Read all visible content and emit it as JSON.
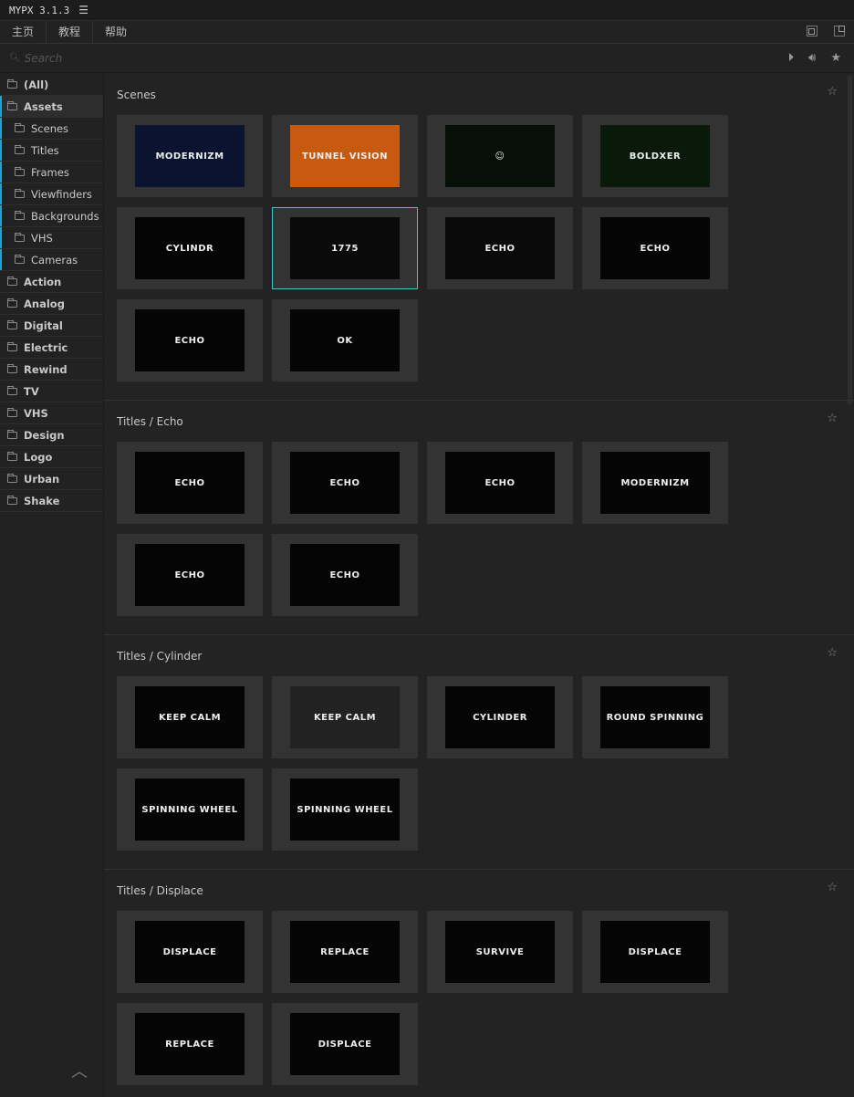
{
  "app": {
    "title": "MYPX 3.1.3",
    "menu_icon": "hamburger-icon"
  },
  "menu": [
    "主页",
    "教程",
    "帮助"
  ],
  "search": {
    "placeholder": "Search",
    "value": ""
  },
  "toolbar_icons": [
    "play-icon",
    "volume-icon",
    "star-icon"
  ],
  "sidebar": [
    {
      "label": "(All)",
      "sub": false
    },
    {
      "label": "Assets",
      "sub": false,
      "active": true
    },
    {
      "label": "Scenes",
      "sub": true
    },
    {
      "label": "Titles",
      "sub": true
    },
    {
      "label": "Frames",
      "sub": true
    },
    {
      "label": "Viewfinders",
      "sub": true
    },
    {
      "label": "Backgrounds",
      "sub": true
    },
    {
      "label": "VHS",
      "sub": true
    },
    {
      "label": "Cameras",
      "sub": true
    },
    {
      "label": "Action",
      "sub": false
    },
    {
      "label": "Analog",
      "sub": false
    },
    {
      "label": "Digital",
      "sub": false
    },
    {
      "label": "Electric",
      "sub": false
    },
    {
      "label": "Rewind",
      "sub": false
    },
    {
      "label": "TV",
      "sub": false
    },
    {
      "label": "VHS",
      "sub": false
    },
    {
      "label": "Design",
      "sub": false
    },
    {
      "label": "Logo",
      "sub": false
    },
    {
      "label": "Urban",
      "sub": false
    },
    {
      "label": "Shake",
      "sub": false
    }
  ],
  "sections": [
    {
      "title": "Scenes",
      "items": [
        {
          "label": "MODERNIZM",
          "bg": "#0a1430"
        },
        {
          "label": "TUNNEL VISION",
          "bg": "#c85a10"
        },
        {
          "label": "☺",
          "bg": "#061008"
        },
        {
          "label": "BOLDXER",
          "bg": "#0a1a0a"
        },
        {
          "label": "CYLINDR",
          "bg": "#050505"
        },
        {
          "label": "1775",
          "bg": "#0a0a0a",
          "selected": true
        },
        {
          "label": "ECHO",
          "bg": "#0a0a0a"
        },
        {
          "label": "ECHO",
          "bg": "#050505"
        },
        {
          "label": "ECHO",
          "bg": "#050505"
        },
        {
          "label": "OK",
          "bg": "#050505"
        }
      ]
    },
    {
      "title": "Titles / Echo",
      "items": [
        {
          "label": "ECHO",
          "bg": "#050505"
        },
        {
          "label": "ECHO",
          "bg": "#050505"
        },
        {
          "label": "ECHO",
          "bg": "#050505"
        },
        {
          "label": "MODERNIZM",
          "bg": "#050505"
        },
        {
          "label": "ECHO",
          "bg": "#050505"
        },
        {
          "label": "ECHO",
          "bg": "#050505"
        }
      ]
    },
    {
      "title": "Titles / Cylinder",
      "items": [
        {
          "label": "KEEP CALM",
          "bg": "#050505"
        },
        {
          "label": "KEEP CALM",
          "bg": "#222"
        },
        {
          "label": "CYLINDER",
          "bg": "#050505"
        },
        {
          "label": "ROUND SPINNING",
          "bg": "#050505"
        },
        {
          "label": "SPINNING WHEEL",
          "bg": "#050505"
        },
        {
          "label": "SPINNING WHEEL",
          "bg": "#050505"
        }
      ]
    },
    {
      "title": "Titles / Displace",
      "items": [
        {
          "label": "DISPLACE",
          "bg": "#050505"
        },
        {
          "label": "REPLACE",
          "bg": "#050505"
        },
        {
          "label": "SURVIVE",
          "bg": "#050505"
        },
        {
          "label": "DISPLACE",
          "bg": "#050505"
        },
        {
          "label": "REPLACE",
          "bg": "#050505"
        },
        {
          "label": "DISPLACE",
          "bg": "#050505"
        }
      ]
    }
  ],
  "colors": {
    "accent": "#1aa7d6",
    "selected": "#3fc6c6"
  }
}
